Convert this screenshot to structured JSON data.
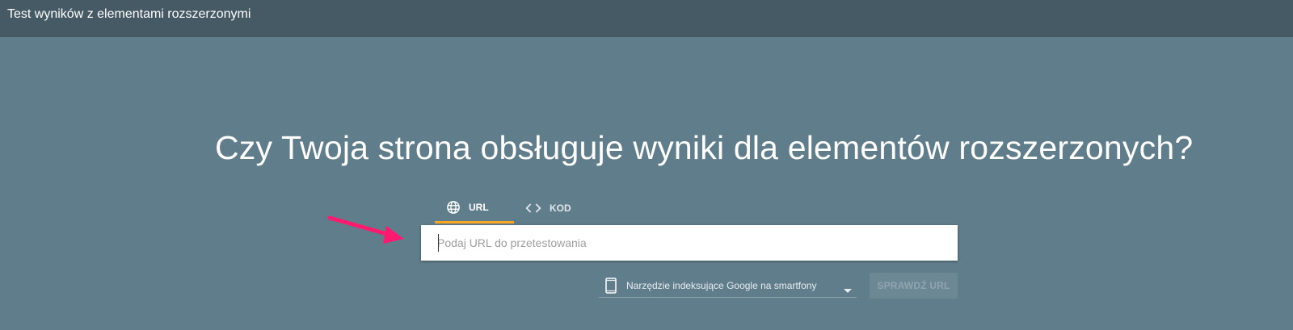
{
  "app": {
    "title": "Test wyników z elementami rozszerzonymi"
  },
  "main": {
    "headline": "Czy Twoja strona obsługuje wyniki dla elementów rozszerzonych?",
    "tabs": [
      {
        "label": "URL",
        "icon": "globe-icon",
        "active": true
      },
      {
        "label": "KOD",
        "icon": "code-icon",
        "active": false
      }
    ],
    "url_input": {
      "value": "",
      "placeholder": "Podaj URL do przetestowania"
    },
    "crawler_select": {
      "icon": "smartphone-icon",
      "selected": "Narzędzie indeksujące Google na smartfony"
    },
    "check_button": {
      "label": "SPRAWDŹ URL",
      "enabled": false
    }
  },
  "colors": {
    "header_bg": "#455a64",
    "page_bg": "#607d8b",
    "tab_indicator": "#f9a825",
    "arrow": "#ff1a6e"
  }
}
